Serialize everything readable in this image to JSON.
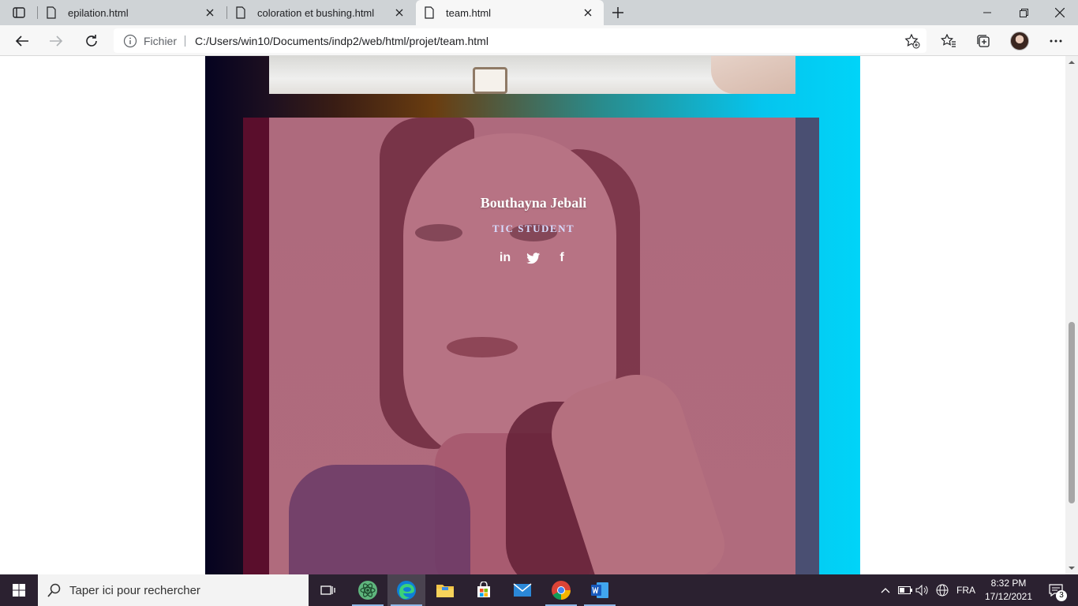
{
  "browser": {
    "tabs": [
      {
        "title": "epilation.html",
        "icon": "page-icon"
      },
      {
        "title": "coloration et bushing.html",
        "icon": "page-icon"
      },
      {
        "title": "team.html",
        "icon": "page-icon",
        "active": true
      }
    ],
    "address_bar": {
      "scheme_label": "Fichier",
      "url": "C:/Users/win10/Documents/indp2/web/html/projet/team.html"
    },
    "toolbar_icons": [
      "back-icon",
      "forward-icon",
      "refresh-icon",
      "info-icon",
      "add-favorite-icon",
      "favorites-icon",
      "collections-icon",
      "profile-avatar",
      "more-icon"
    ]
  },
  "page": {
    "member": {
      "name": "Bouthayna Jebali",
      "role": "TIC STUDENT",
      "social": [
        "linkedin-icon",
        "twitter-icon",
        "facebook-icon"
      ]
    },
    "social_glyphs": {
      "linkedin": "in",
      "facebook": "f"
    }
  },
  "taskbar": {
    "search_placeholder": "Taper ici pour rechercher",
    "apps": [
      "task-view-icon",
      "atom-icon",
      "edge-icon",
      "file-explorer-icon",
      "store-icon",
      "mail-icon",
      "chrome-icon",
      "word-icon"
    ],
    "language": "FRA",
    "time": "8:32 PM",
    "date": "17/12/2021",
    "notification_count": "3"
  },
  "colors": {
    "tabstrip_bg": "#cfd3d6",
    "card_overlay": "#ae6a7d",
    "role_text": "#d7dcff",
    "taskbar_bg": "#2b2130"
  }
}
